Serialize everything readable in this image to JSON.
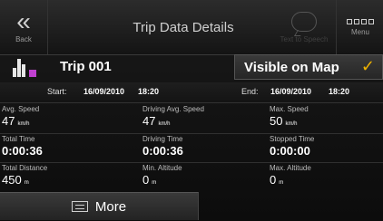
{
  "header": {
    "back_label": "Back",
    "title": "Trip Data Details",
    "tts_label": "Text to Speech",
    "menu_label": "Menu"
  },
  "trip": {
    "name": "Trip 001",
    "visible_label": "Visible on Map",
    "visible_checked": true
  },
  "dates": {
    "start_label": "Start:",
    "start_date": "16/09/2010",
    "start_time": "18:20",
    "end_label": "End:",
    "end_date": "16/09/2010",
    "end_time": "18:20"
  },
  "stats": {
    "avg_speed": {
      "label": "Avg. Speed",
      "value": "47",
      "unit": "km/h"
    },
    "driving_avg_speed": {
      "label": "Driving Avg. Speed",
      "value": "47",
      "unit": "km/h"
    },
    "max_speed": {
      "label": "Max. Speed",
      "value": "50",
      "unit": "km/h"
    },
    "total_time": {
      "label": "Total Time",
      "value": "0:00:36"
    },
    "driving_time": {
      "label": "Driving Time",
      "value": "0:00:36"
    },
    "stopped_time": {
      "label": "Stopped Time",
      "value": "0:00:00"
    },
    "total_distance": {
      "label": "Total Distance",
      "value": "450",
      "unit": "m"
    },
    "min_altitude": {
      "label": "Min. Altitude",
      "value": "0",
      "unit": "m"
    },
    "max_altitude": {
      "label": "Max. Altitude",
      "value": "0",
      "unit": "m"
    }
  },
  "footer": {
    "more_label": "More"
  },
  "colors": {
    "accent_check": "#f0b400",
    "trip_icon_marker": "#c040d0"
  },
  "icons": [
    "back-chevron-icon",
    "speech-bubble-icon",
    "menu-grid-icon",
    "trip-chart-icon",
    "checkmark-icon",
    "more-list-icon"
  ]
}
